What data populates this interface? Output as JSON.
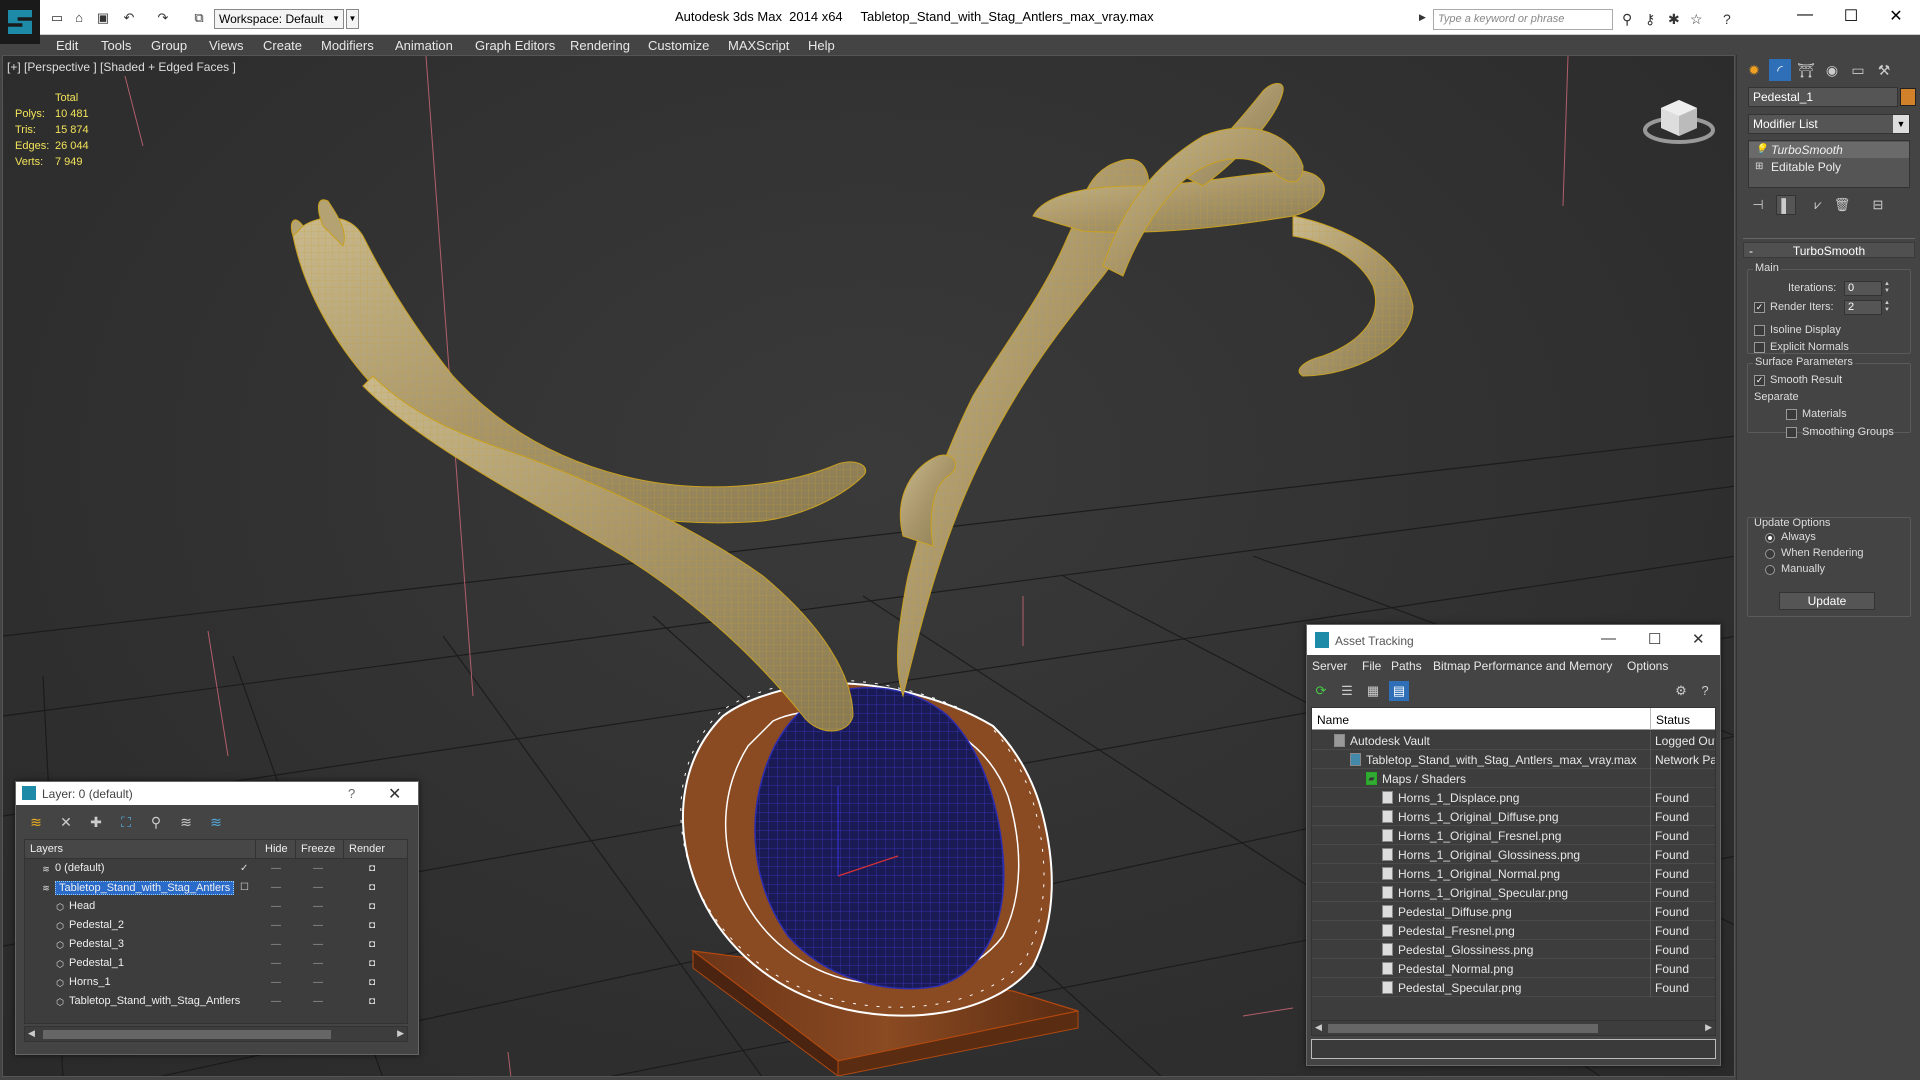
{
  "titlebar": {
    "workspace": "Workspace: Default",
    "app_name": "Autodesk 3ds Max  2014 x64",
    "file_name": "Tabletop_Stand_with_Stag_Antlers_max_vray.max",
    "search_placeholder": "Type a keyword or phrase",
    "quick_access_icons": [
      "new-icon",
      "open-icon",
      "save-icon",
      "undo-icon",
      "redo-icon",
      "project-icon"
    ],
    "help_icons": [
      "binoculars-icon",
      "key-icon",
      "star-network-icon",
      "favorites-star-icon",
      "help-icon"
    ]
  },
  "menu": [
    "Edit",
    "Tools",
    "Group",
    "Views",
    "Create",
    "Modifiers",
    "Animation",
    "Graph Editors",
    "Rendering",
    "Customize",
    "MAXScript",
    "Help"
  ],
  "viewport": {
    "label": "[+] [Perspective ] [Shaded + Edged Faces ]",
    "stats": {
      "header": "Total",
      "rows": [
        {
          "key": "Polys:",
          "value": "10 481"
        },
        {
          "key": "Tris:",
          "value": "15 874"
        },
        {
          "key": "Edges:",
          "value": "26 044"
        },
        {
          "key": "Verts:",
          "value": "7 949"
        }
      ]
    }
  },
  "command_panel": {
    "tabs": [
      "create-icon",
      "modify-icon",
      "hierarchy-icon",
      "motion-icon",
      "display-icon",
      "utilities-icon"
    ],
    "object_name": "Pedestal_1",
    "object_color": "#d2812b",
    "modifier_list": "Modifier List",
    "stack": [
      "TurboSmooth",
      "Editable Poly"
    ],
    "rollout_title": "TurboSmooth",
    "main_group": "Main",
    "iterations_label": "Iterations:",
    "iterations_value": "0",
    "render_iters_label": "Render Iters:",
    "render_iters_value": "2",
    "render_iters_checked": true,
    "isoline_display": "Isoline Display",
    "explicit_normals": "Explicit Normals",
    "surface_params": "Surface Parameters",
    "smooth_result": "Smooth Result",
    "separate": "Separate",
    "materials": "Materials",
    "smoothing_groups": "Smoothing Groups",
    "update_options": "Update Options",
    "always": "Always",
    "when_rendering": "When Rendering",
    "manually": "Manually",
    "update_button": "Update"
  },
  "layer_explorer": {
    "title": "Layer: 0 (default)",
    "columns": [
      "Layers",
      "Hide",
      "Freeze",
      "Render"
    ],
    "rows": [
      {
        "name": "0 (default)",
        "type": "layer",
        "active": true
      },
      {
        "name": "Tabletop_Stand_with_Stag_Antlers",
        "type": "layer",
        "selected": true
      },
      {
        "name": "Head",
        "type": "object"
      },
      {
        "name": "Pedestal_2",
        "type": "object"
      },
      {
        "name": "Pedestal_3",
        "type": "object"
      },
      {
        "name": "Pedestal_1",
        "type": "object"
      },
      {
        "name": "Horns_1",
        "type": "object"
      },
      {
        "name": "Tabletop_Stand_with_Stag_Antlers",
        "type": "object"
      }
    ]
  },
  "asset_tracking": {
    "title": "Asset Tracking",
    "menu": [
      "Server",
      "File",
      "Paths",
      "Bitmap Performance and Memory",
      "Options"
    ],
    "columns": [
      "Name",
      "Status"
    ],
    "rows": [
      {
        "name": "Autodesk Vault",
        "status": "Logged Out",
        "level": 1
      },
      {
        "name": "Tabletop_Stand_with_Stag_Antlers_max_vray.max",
        "status": "Network Path",
        "level": 2
      },
      {
        "name": "Maps / Shaders",
        "status": "",
        "level": 3
      },
      {
        "name": "Horns_1_Displace.png",
        "status": "Found",
        "level": 4
      },
      {
        "name": "Horns_1_Original_Diffuse.png",
        "status": "Found",
        "level": 4
      },
      {
        "name": "Horns_1_Original_Fresnel.png",
        "status": "Found",
        "level": 4
      },
      {
        "name": "Horns_1_Original_Glossiness.png",
        "status": "Found",
        "level": 4
      },
      {
        "name": "Horns_1_Original_Normal.png",
        "status": "Found",
        "level": 4
      },
      {
        "name": "Horns_1_Original_Specular.png",
        "status": "Found",
        "level": 4
      },
      {
        "name": "Pedestal_Diffuse.png",
        "status": "Found",
        "level": 4
      },
      {
        "name": "Pedestal_Fresnel.png",
        "status": "Found",
        "level": 4
      },
      {
        "name": "Pedestal_Glossiness.png",
        "status": "Found",
        "level": 4
      },
      {
        "name": "Pedestal_Normal.png",
        "status": "Found",
        "level": 4
      },
      {
        "name": "Pedestal_Specular.png",
        "status": "Found",
        "level": 4
      }
    ]
  }
}
